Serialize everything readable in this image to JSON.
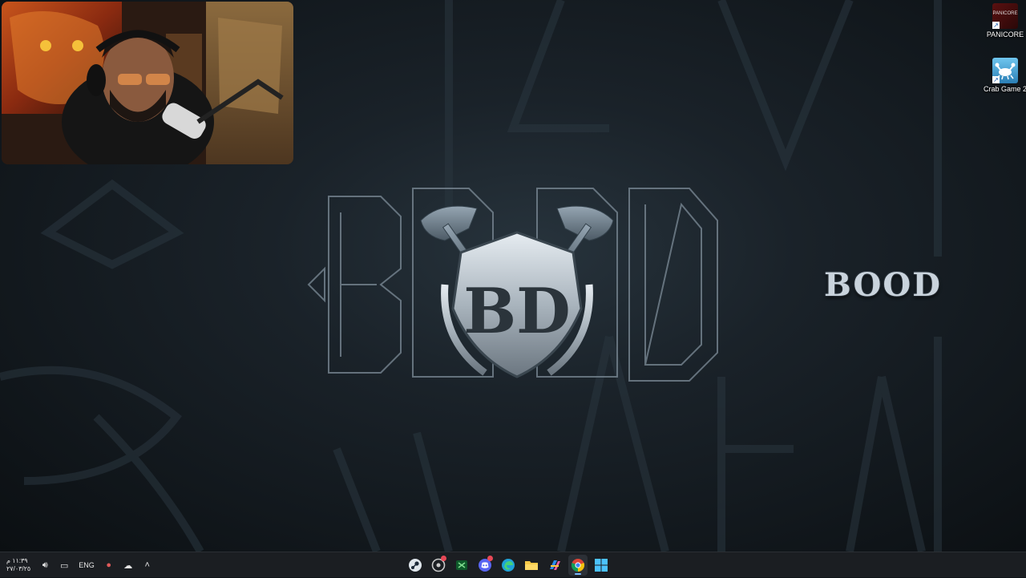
{
  "desktop": {
    "icons": [
      {
        "label": "PANICORE",
        "icon": "panicore-game-icon",
        "thumb_text": "PANICORE"
      },
      {
        "label": "Crab Game 2",
        "icon": "crab-game-icon"
      }
    ],
    "wallpaper_text": "BOOD",
    "logo_letters": "BD",
    "webcam": {
      "icon": "streamer-webcam-feed"
    }
  },
  "taskbar": {
    "clock": {
      "time": "١١:٣٩ م",
      "date": "٢٧/٠٣/٢٥"
    },
    "language": "ENG",
    "tray_icons": [
      "speaker-icon",
      "display-icon",
      "microphone-icon",
      "onedrive-cloud-icon",
      "show-hidden-icons-chevron"
    ],
    "apps": [
      {
        "name": "steam-icon",
        "active": false,
        "badge": false
      },
      {
        "name": "discord-bot-icon",
        "active": false,
        "badge": true
      },
      {
        "name": "xbox-app-icon",
        "active": false,
        "badge": false
      },
      {
        "name": "discord-icon",
        "active": false,
        "badge": true
      },
      {
        "name": "edge-icon",
        "active": false,
        "badge": false
      },
      {
        "name": "file-explorer-icon",
        "active": false,
        "badge": false
      },
      {
        "name": "copilot-icon",
        "active": false,
        "badge": false
      },
      {
        "name": "chrome-icon",
        "active": true,
        "badge": false
      },
      {
        "name": "start-button-icon",
        "active": false,
        "badge": false
      }
    ]
  },
  "colors": {
    "wallpaper": "#1a2229",
    "taskbar": "#1b1e22",
    "logo_metal": "#b9c3cc",
    "active_indicator": "#79b8ff"
  }
}
